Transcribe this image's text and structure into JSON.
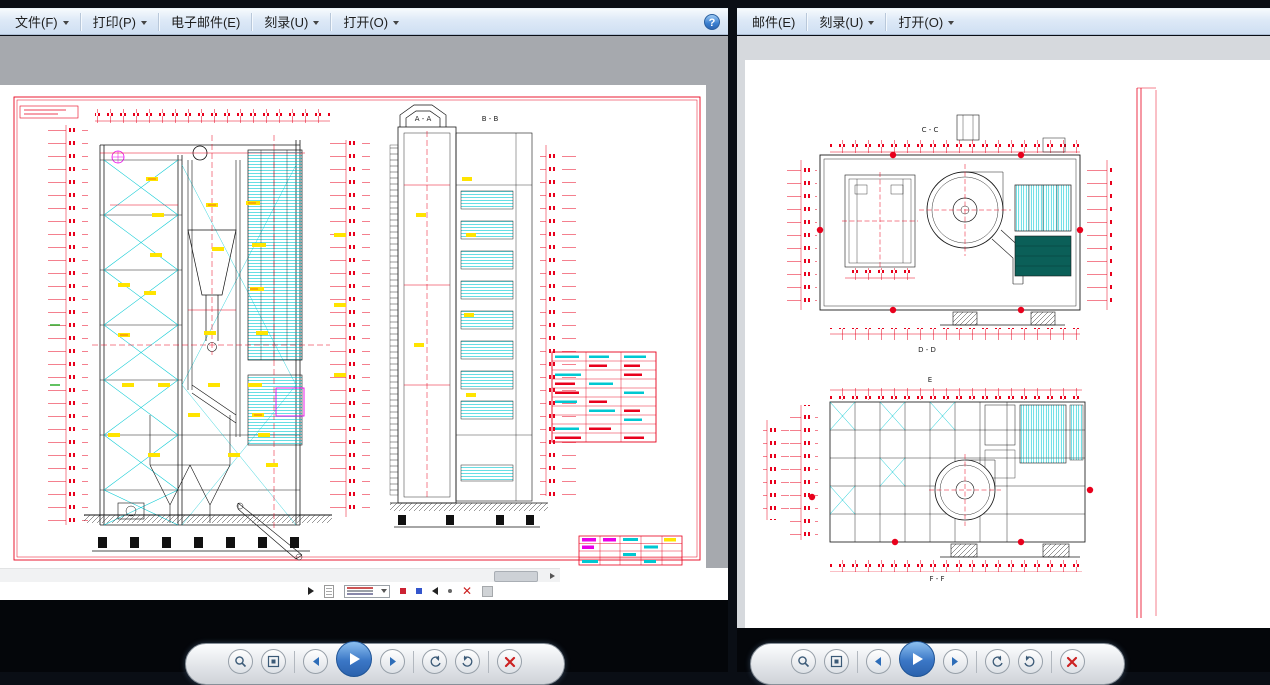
{
  "left_window": {
    "menu": {
      "items": [
        {
          "label": "文件(F)",
          "has_dropdown": true
        },
        {
          "label": "打印(P)",
          "has_dropdown": true
        },
        {
          "label": "电子邮件(E)",
          "has_dropdown": false
        },
        {
          "label": "刻录(U)",
          "has_dropdown": true
        },
        {
          "label": "打开(O)",
          "has_dropdown": true
        }
      ],
      "help_label": "?"
    },
    "drawing": {
      "description": "boiler general arrangement elevation views",
      "section_labels": [
        "A - A",
        "B - B"
      ]
    }
  },
  "right_window": {
    "menu": {
      "items": [
        {
          "label": "邮件(E)",
          "has_dropdown": false
        },
        {
          "label": "刻录(U)",
          "has_dropdown": true
        },
        {
          "label": "打开(O)",
          "has_dropdown": true
        }
      ]
    },
    "drawing": {
      "description": "boiler plan section views with fan volute",
      "section_labels": [
        "C - C",
        "D - D",
        "E",
        "F - F"
      ]
    }
  },
  "colors": {
    "dimension_red": "#e8001c",
    "cad_cyan": "#00c8d2",
    "highlight_yellow": "#ffe400",
    "cad_magenta": "#e800e8",
    "menu_bar_blue": "#dde9f7",
    "play_button_blue": "#3b77c6",
    "desktop_background": "#0a0e15"
  }
}
